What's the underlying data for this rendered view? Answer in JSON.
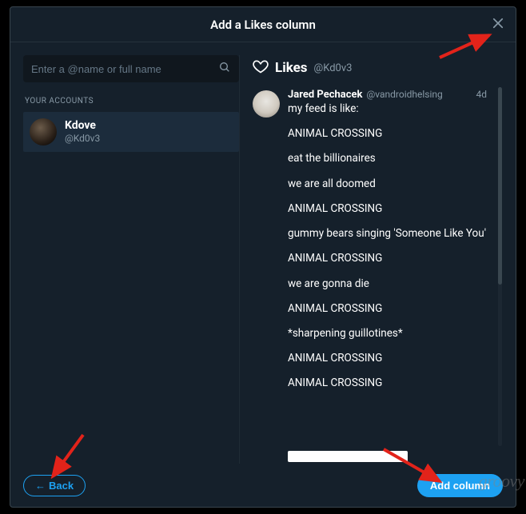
{
  "modal": {
    "title": "Add a Likes column",
    "back_label": "Back",
    "add_label": "Add column"
  },
  "search": {
    "placeholder": "Enter a @name or full name"
  },
  "sidebar": {
    "accounts_label": "YOUR ACCOUNTS",
    "account": {
      "name": "Kdove",
      "handle": "@Kd0v3"
    }
  },
  "column": {
    "title": "Likes",
    "handle": "@Kd0v3"
  },
  "tweet": {
    "author": "Jared Pechacek",
    "handle": "@vandroidhelsing",
    "time": "4d",
    "lines": [
      "my feed is like:",
      "ANIMAL CROSSING",
      "eat the billionaires",
      "we are all doomed",
      "ANIMAL CROSSING",
      "gummy bears singing 'Someone Like You'",
      "ANIMAL CROSSING",
      "we are gonna die",
      "ANIMAL CROSSING",
      "*sharpening guillotines*",
      "ANIMAL CROSSING",
      "ANIMAL CROSSING"
    ]
  },
  "watermark": "groovy"
}
